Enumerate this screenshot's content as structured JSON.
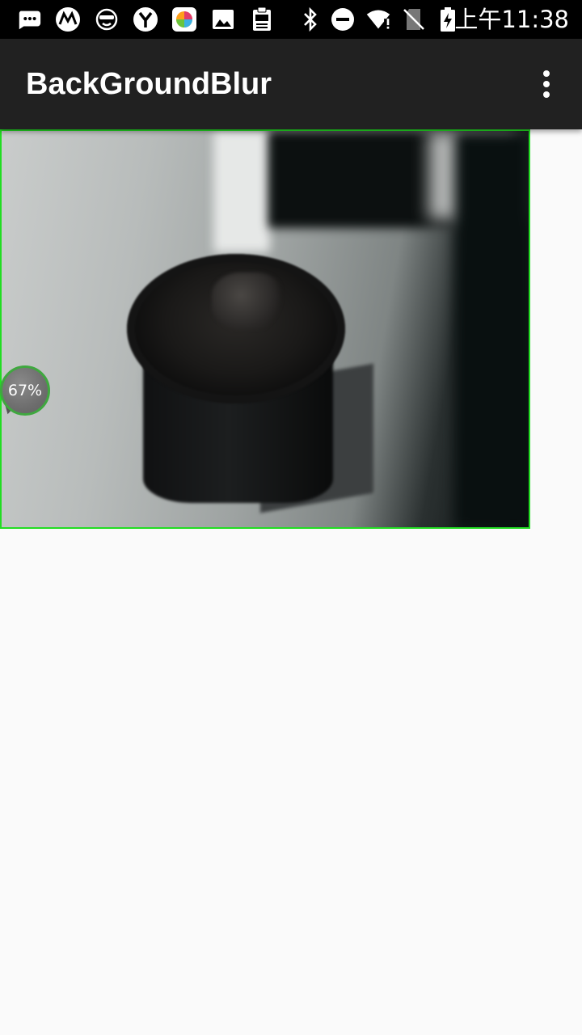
{
  "status_bar": {
    "time": "上午11:38",
    "notification_icons": [
      "messages-icon",
      "motorola-icon",
      "face-mask-icon",
      "yandex-icon",
      "photo-app-icon",
      "gallery-icon",
      "log-icon"
    ],
    "system_icons": [
      "bluetooth-icon",
      "do-not-disturb-icon",
      "wifi-icon",
      "no-sim-icon",
      "battery-charging-icon"
    ]
  },
  "app_bar": {
    "title": "BackGroundBlur",
    "overflow_icon": "more-vert-icon"
  },
  "preview": {
    "border_color": "#22dd22",
    "badge_text": "67%",
    "badge_ring_color": "#3fa83f",
    "progress_percent": 67
  }
}
